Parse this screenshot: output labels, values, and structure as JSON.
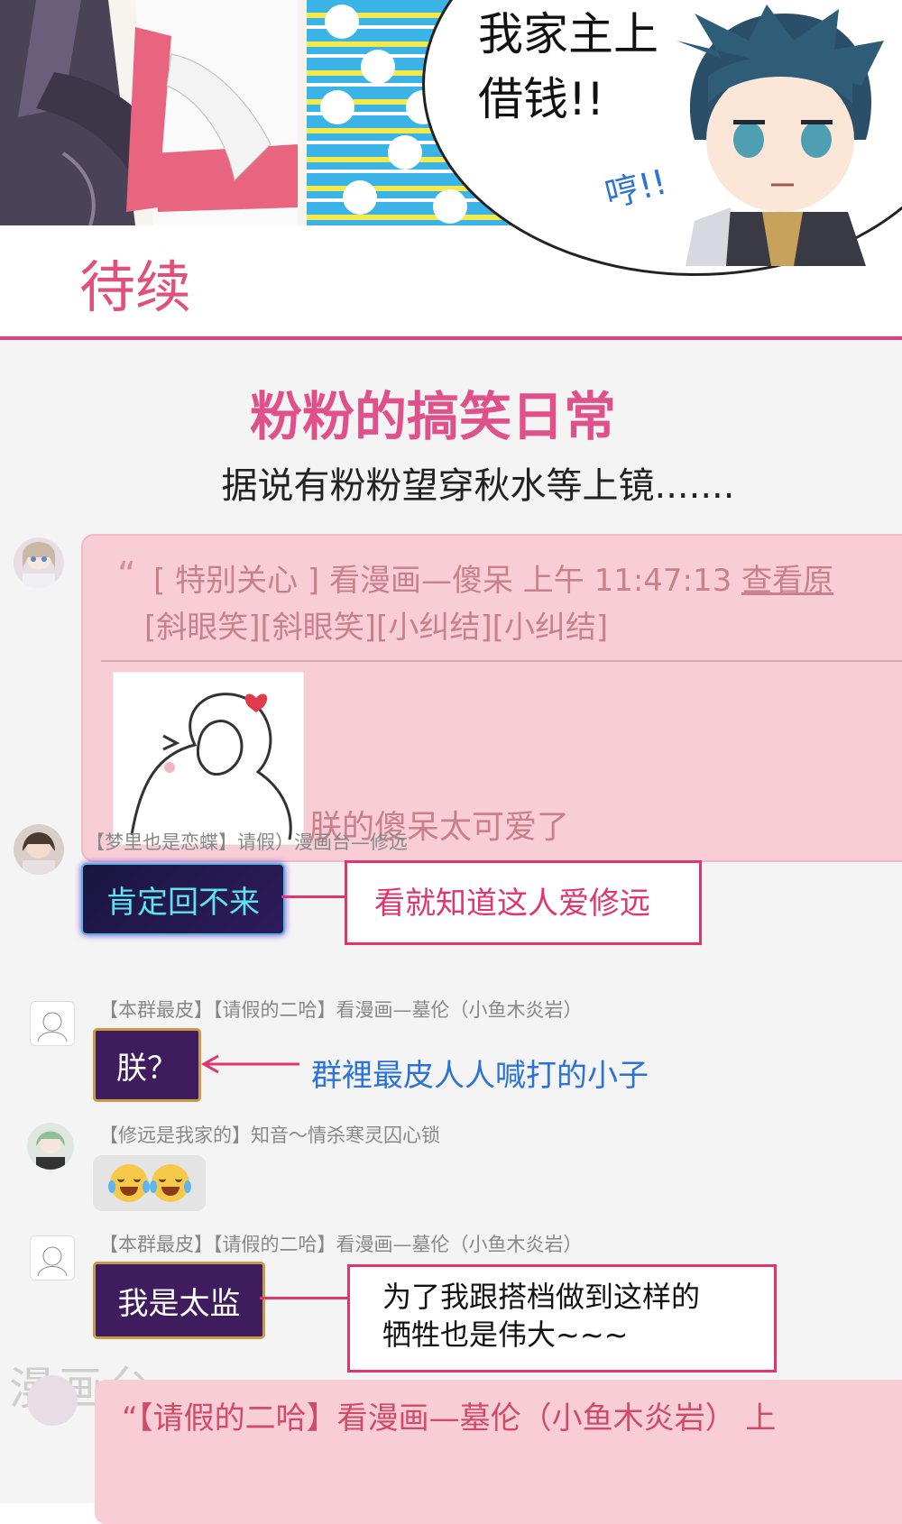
{
  "comic": {
    "speech_bubble": "我家主上\n借钱!!",
    "humph": "哼!!",
    "to_be_continued": "待续"
  },
  "section": {
    "title": "粉粉的搞笑日常",
    "subtitle": "据说有粉粉望穿秋水等上镜......."
  },
  "quoted_card": {
    "quote_mark": "“",
    "header": "[ 特别关心 ] 看漫画—傻呆   上午 11:47:13 ",
    "view_original": "查看原",
    "stickers_text": "[斜眼笑][斜眼笑][小纠结][小纠结]",
    "message": "朕的傻呆太可爱了"
  },
  "messages": [
    {
      "sender": "【梦里也是恋蝶】请假）漫画台—修远",
      "text": "肯定回不来"
    },
    {
      "sender": "【本群最皮】【请假的二哈】看漫画—墓伦（小鱼木炎岩）",
      "text": "朕？"
    },
    {
      "sender": "【修远是我家的】知音～情杀寒灵囚心锁",
      "text": ""
    },
    {
      "sender": "【本群最皮】【请假的二哈】看漫画—墓伦（小鱼木炎岩）",
      "text": "我是太监"
    }
  ],
  "annotations": {
    "note1": "看就知道这人爱修远",
    "note2": "群裡最皮人人喊打的小子",
    "note3": "为了我跟搭档做到这样的\n牺牲也是伟大~~~"
  },
  "footer": {
    "watermark": "漫画台",
    "partial_line": "“【请假的二哈】看漫画—墓伦（小鱼木炎岩）  上"
  },
  "colors": {
    "accent_pink": "#e0356f",
    "title_pink": "#e0508a",
    "blue_note": "#2b73d6"
  }
}
